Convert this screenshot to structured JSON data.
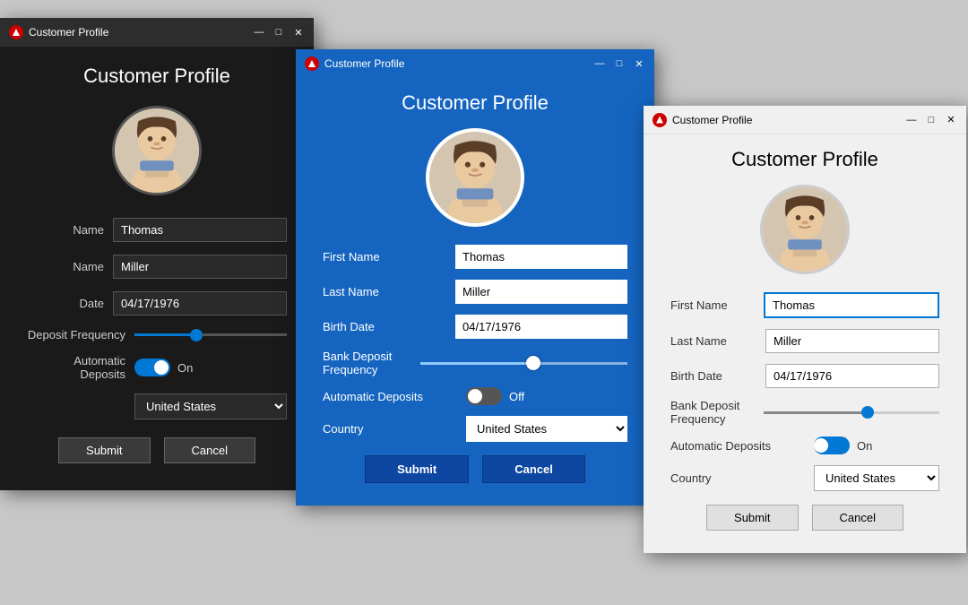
{
  "app": {
    "title": "Customer Profile",
    "icon_label": "app-icon"
  },
  "dark_window": {
    "title_bar": {
      "text": "Customer Profile",
      "minimize": "—",
      "maximize": "□",
      "close": "✕"
    },
    "heading": "Customer Profile",
    "fields": {
      "first_name_label": "ame",
      "first_name_value": "Thomas",
      "last_name_label": "ame",
      "last_name_value": "Miller",
      "birth_date_label": "ate",
      "birth_date_value": "04/17/1976",
      "deposit_freq_label": "eposit Frequency",
      "auto_deposits_label": "tic Deposits",
      "auto_deposits_state": "On",
      "country_label": "",
      "country_value": "United States"
    },
    "buttons": {
      "submit": "Submit",
      "cancel": "Cancel"
    }
  },
  "blue_window": {
    "title_bar": {
      "text": "Customer Profile",
      "minimize": "—",
      "maximize": "□",
      "close": "✕"
    },
    "heading": "Customer Profile",
    "fields": {
      "first_name_label": "First Name",
      "first_name_value": "Thomas",
      "last_name_label": "Last Name",
      "last_name_value": "Miller",
      "birth_date_label": "Birth Date",
      "birth_date_value": "04/17/1976",
      "deposit_freq_label": "Bank Deposit Frequency",
      "auto_deposits_label": "Automatic Deposits",
      "auto_deposits_state": "Off",
      "country_label": "Country",
      "country_value": "United States"
    },
    "buttons": {
      "submit": "Submit",
      "cancel": "Cancel"
    }
  },
  "white_window": {
    "title_bar": {
      "text": "Customer Profile",
      "minimize": "—",
      "maximize": "□",
      "close": "✕"
    },
    "heading": "Customer Profile",
    "fields": {
      "first_name_label": "First Name",
      "first_name_value": "Thomas",
      "last_name_label": "Last Name",
      "last_name_value": "Miller",
      "birth_date_label": "Birth Date",
      "birth_date_value": "04/17/1976",
      "deposit_freq_label": "Bank Deposit Frequency",
      "auto_deposits_label": "Automatic Deposits",
      "auto_deposits_state": "On",
      "country_label": "Country",
      "country_value": "United States"
    },
    "buttons": {
      "submit": "Submit",
      "cancel": "Cancel"
    }
  }
}
